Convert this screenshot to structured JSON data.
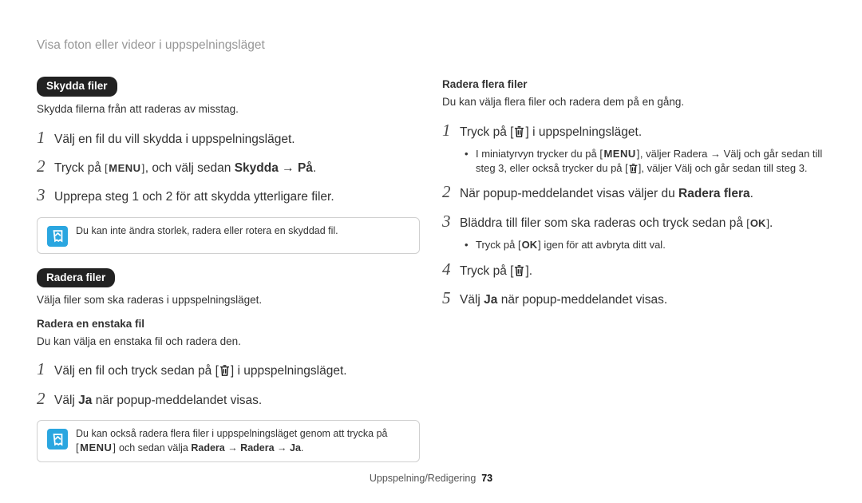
{
  "header": "Visa foton eller videor i uppspelningsläget",
  "icons": {
    "menu": "MENU",
    "ok": "OK"
  },
  "left": {
    "protect": {
      "title": "Skydda filer",
      "desc": "Skydda filerna från att raderas av misstag.",
      "steps": {
        "s1": "Välj en fil du vill skydda i uppspelningsläget.",
        "s2_a": "Tryck på ",
        "s2_b": ", och välj sedan ",
        "s2_bold": "Skydda → På",
        "s2_c": ".",
        "s3": "Upprepa steg 1 och 2 för att skydda ytterligare filer."
      },
      "note": "Du kan inte ändra storlek, radera eller rotera en skyddad fil."
    },
    "delete": {
      "title": "Radera filer",
      "desc": "Välja filer som ska raderas i uppspelningsläget.",
      "single": {
        "heading": "Radera en enstaka fil",
        "desc": "Du kan välja en enstaka fil och radera den.",
        "s1_a": "Välj en fil och tryck sedan på ",
        "s1_b": " i uppspelningsläget.",
        "s2_a": "Välj ",
        "s2_bold": "Ja",
        "s2_b": " när popup-meddelandet visas."
      },
      "note_a": "Du kan också radera flera filer i uppspelningsläget genom att trycka på ",
      "note_b": " och sedan välja ",
      "note_bold": "Radera → Radera → Ja",
      "note_c": "."
    }
  },
  "right": {
    "multi": {
      "heading": "Radera flera filer",
      "desc": "Du kan välja flera filer och radera dem på en gång.",
      "s1_a": "Tryck på ",
      "s1_b": " i uppspelningsläget.",
      "s1_bullet_a": "I miniatyrvyn trycker du på ",
      "s1_bullet_b": ", väljer ",
      "s1_bullet_bold1": "Radera → Välj",
      "s1_bullet_c": " och går sedan till steg 3, eller också trycker du på ",
      "s1_bullet_d": ", väljer ",
      "s1_bullet_bold2": "Välj",
      "s1_bullet_e": " och går sedan till steg 3.",
      "s2_a": "När popup-meddelandet visas väljer du ",
      "s2_bold": "Radera flera",
      "s2_b": ".",
      "s3_a": "Bläddra till filer som ska raderas och tryck sedan på ",
      "s3_b": ".",
      "s3_bullet_a": "Tryck på ",
      "s3_bullet_b": " igen för att avbryta ditt val.",
      "s4_a": "Tryck på ",
      "s4_b": ".",
      "s5_a": "Välj ",
      "s5_bold": "Ja",
      "s5_b": " när popup-meddelandet visas."
    }
  },
  "footer": {
    "section": "Uppspelning/Redigering",
    "page": "73"
  }
}
